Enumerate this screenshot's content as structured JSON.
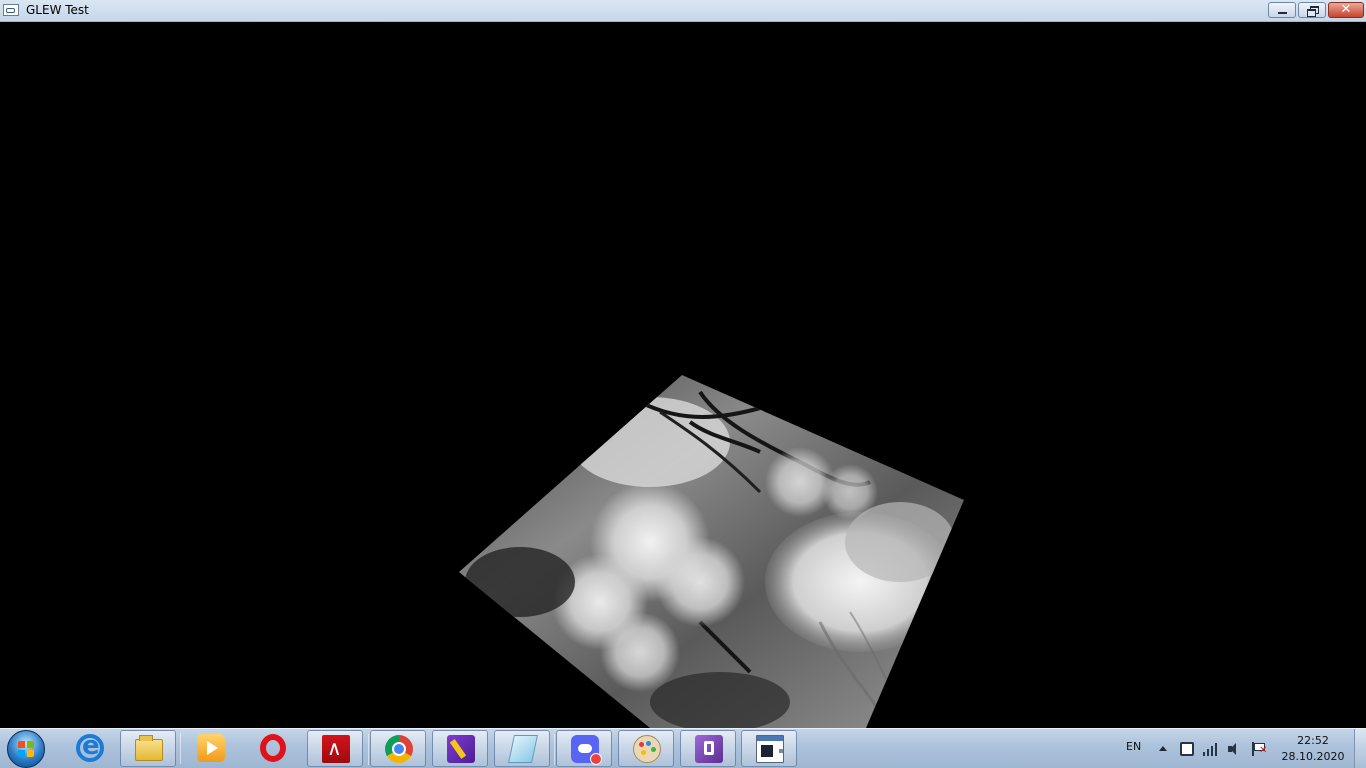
{
  "window": {
    "title": "GLEW Test",
    "close_glyph": "✕"
  },
  "viewport": {
    "background": "#000000",
    "textured_quad": {
      "texture": "grayscale photo of blossoming trees by a pond",
      "corners": [
        "top",
        "right",
        "bottom",
        "left"
      ]
    }
  },
  "taskbar": {
    "start_icon": "windows-orb-icon",
    "items": [
      {
        "name": "internet-explorer",
        "icon": "internet-explorer-icon",
        "active": false
      },
      {
        "name": "file-explorer",
        "icon": "folder-icon",
        "active": true
      },
      {
        "name": "media-player",
        "icon": "media-player-icon",
        "active": false
      },
      {
        "name": "opera",
        "icon": "opera-icon",
        "active": false
      },
      {
        "name": "acrobat",
        "icon": "pdf-icon",
        "active": true
      },
      {
        "name": "chrome",
        "icon": "chrome-icon",
        "active": true
      },
      {
        "name": "notes-app",
        "icon": "notes-icon",
        "active": true
      },
      {
        "name": "card-app",
        "icon": "cards-icon",
        "active": true
      },
      {
        "name": "discord",
        "icon": "discord-icon",
        "active": true
      },
      {
        "name": "paint",
        "icon": "paint-palette-icon",
        "active": true
      },
      {
        "name": "visual-studio",
        "icon": "visual-studio-icon",
        "active": true
      },
      {
        "name": "glew-test",
        "icon": "glew-app-icon",
        "active": true
      }
    ],
    "tray": {
      "language": "EN",
      "time": "22:52",
      "date": "28.10.2020"
    }
  },
  "colors": {
    "titlebar": "#c5d6ea",
    "taskbar": "#aec3dc",
    "close_button": "#c8442c"
  }
}
